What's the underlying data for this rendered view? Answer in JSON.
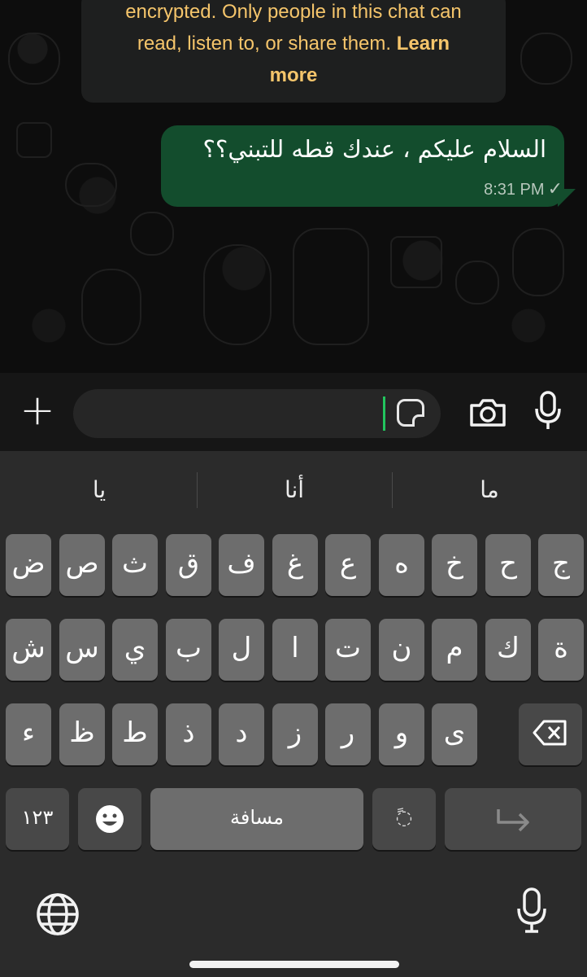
{
  "chat": {
    "encryption_notice": {
      "line1": "encrypted. Only people in this chat can",
      "line2_text": "read, listen to, or share them. ",
      "line2_link": "Learn",
      "line3_link": "more"
    },
    "message": {
      "text": "السلام عليكم ، عندك قطه للتبني؟؟",
      "time": "8:31 PM",
      "status": "✓"
    }
  },
  "input_bar": {
    "plus_label": "+",
    "message_value": ""
  },
  "keyboard": {
    "suggestions": [
      "ما",
      "أنا",
      "يا"
    ],
    "row1": [
      "ج",
      "ح",
      "خ",
      "ه",
      "ع",
      "غ",
      "ف",
      "ق",
      "ث",
      "ص",
      "ض"
    ],
    "row2": [
      "ة",
      "ك",
      "م",
      "ن",
      "ت",
      "ا",
      "ل",
      "ب",
      "ي",
      "س",
      "ش"
    ],
    "row3": [
      "ى",
      "و",
      "ر",
      "ز",
      "د",
      "ذ",
      "ط",
      "ظ",
      "ء"
    ],
    "numbers_label": "١٢٣",
    "space_label": "مسافة",
    "diacritic_label": "ً◌",
    "return_arrow": "⏎"
  }
}
